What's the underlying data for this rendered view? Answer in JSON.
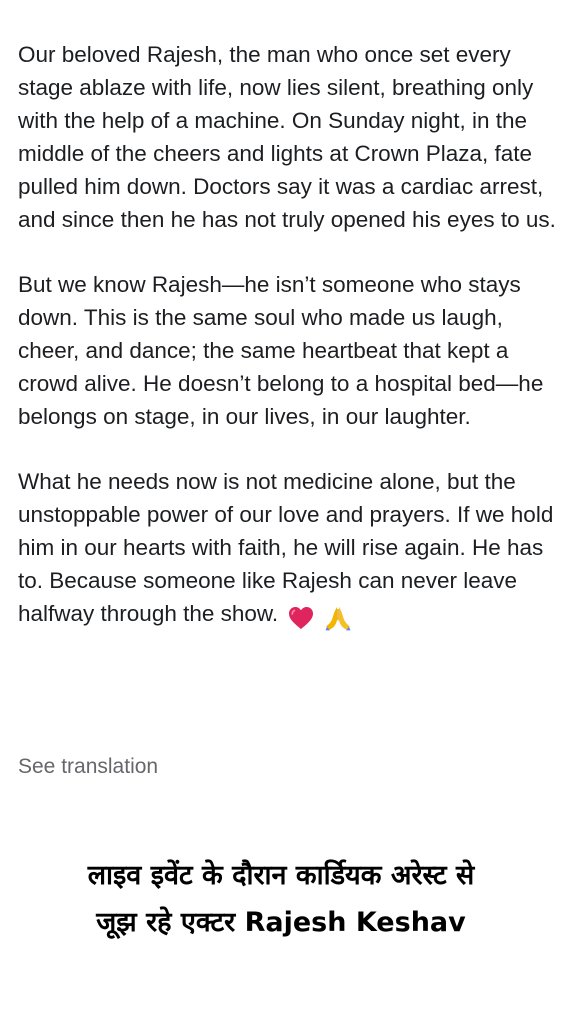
{
  "post": {
    "paragraphs": [
      "Our beloved Rajesh, the man who once set every stage ablaze with life, now lies silent, breathing only with the help of a machine. On Sunday night, in the middle of the cheers and lights at Crown Plaza, fate pulled him down. Doctors say it was a cardiac arrest, and since then he has not truly opened his eyes to us.",
      "But we know Rajesh—he isn’t someone who stays down. This is the same soul who made us laugh, cheer, and dance; the same heartbeat that kept a crowd alive. He doesn’t belong to a hospital bed—he belongs on stage, in our lives, in our laughter.",
      "What he needs now is not medicine alone, but the unstoppable power of our love and prayers. If we hold him in our hearts with faith, he will rise again. He has to. Because someone like Rajesh can never leave halfway through the show."
    ],
    "emojis": [
      "heart-emoji",
      "praying-hands-emoji"
    ],
    "see_translation": "See translation"
  },
  "caption": {
    "line1": "लाइव इवेंट के दौरान कार्डियक अरेस्ट से",
    "line2": "जूझ रहे एक्टर Rajesh Keshav"
  },
  "colors": {
    "text": "#1c1e21",
    "muted": "#65676b",
    "heart": "#e0245e",
    "hands": "#f4b400"
  }
}
